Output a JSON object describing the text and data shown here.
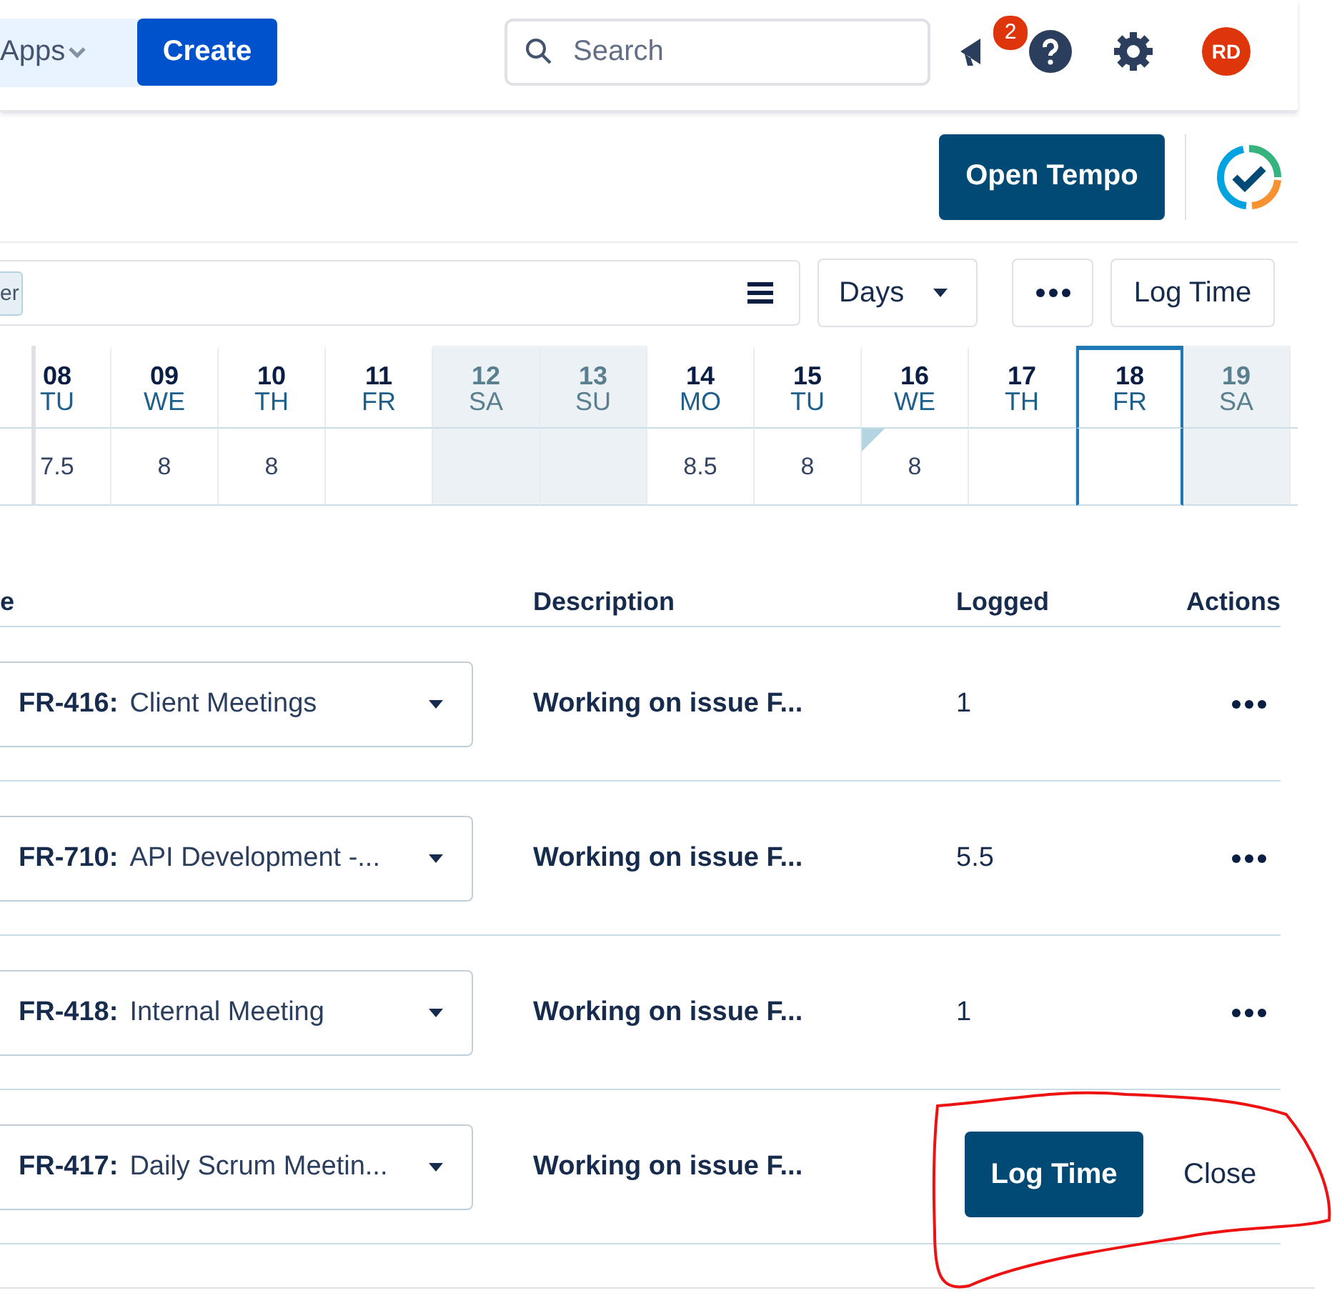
{
  "topbar": {
    "apps_label": "Apps",
    "create_label": "Create",
    "search": {
      "placeholder": "Search"
    },
    "notification_count": "2",
    "avatar_initials": "RD"
  },
  "header": {
    "open_tempo_label": "Open Tempo"
  },
  "toolbar": {
    "filter_tag": "er",
    "view_dropdown": "Days",
    "log_time_label": "Log Time"
  },
  "calendar": {
    "days": [
      {
        "date": "08",
        "weekday": "TU",
        "hours": "7.5",
        "weekend": false,
        "selected": false,
        "flagged": false
      },
      {
        "date": "09",
        "weekday": "WE",
        "hours": "8",
        "weekend": false,
        "selected": false,
        "flagged": false
      },
      {
        "date": "10",
        "weekday": "TH",
        "hours": "8",
        "weekend": false,
        "selected": false,
        "flagged": false
      },
      {
        "date": "11",
        "weekday": "FR",
        "weekend": false,
        "selected": false,
        "flagged": false
      },
      {
        "date": "12",
        "weekday": "SA",
        "weekend": true,
        "selected": false,
        "flagged": false
      },
      {
        "date": "13",
        "weekday": "SU",
        "weekend": true,
        "selected": false,
        "flagged": false
      },
      {
        "date": "14",
        "weekday": "MO",
        "hours": "8.5",
        "weekend": false,
        "selected": false,
        "flagged": false
      },
      {
        "date": "15",
        "weekday": "TU",
        "hours": "8",
        "weekend": false,
        "selected": false,
        "flagged": false
      },
      {
        "date": "16",
        "weekday": "WE",
        "hours": "8",
        "weekend": false,
        "selected": false,
        "flagged": true
      },
      {
        "date": "17",
        "weekday": "TH",
        "weekend": false,
        "selected": false,
        "flagged": false
      },
      {
        "date": "18",
        "weekday": "FR",
        "weekend": false,
        "selected": true,
        "flagged": false
      },
      {
        "date": "19",
        "weekday": "SA",
        "weekend": true,
        "selected": false,
        "flagged": false
      }
    ]
  },
  "worklogs": {
    "columns": [
      "e",
      "Description",
      "Logged",
      "Actions"
    ],
    "rows": [
      {
        "issue_key": "FR-416:",
        "issue_summary": "Client Meetings",
        "description": "Working on issue F...",
        "logged": "1",
        "menu": true
      },
      {
        "issue_key": "FR-710:",
        "issue_summary": "API Development -...",
        "description": "Working on issue F...",
        "logged": "5.5",
        "menu": true
      },
      {
        "issue_key": "FR-418:",
        "issue_summary": "Internal Meeting",
        "description": "Working on issue F...",
        "logged": "1",
        "menu": true
      },
      {
        "issue_key": "FR-417:",
        "issue_summary": "Daily Scrum Meetin...",
        "description": "Working on issue F...",
        "menu": false
      }
    ]
  },
  "popup": {
    "primary_label": "Log Time",
    "secondary_label": "Close"
  }
}
